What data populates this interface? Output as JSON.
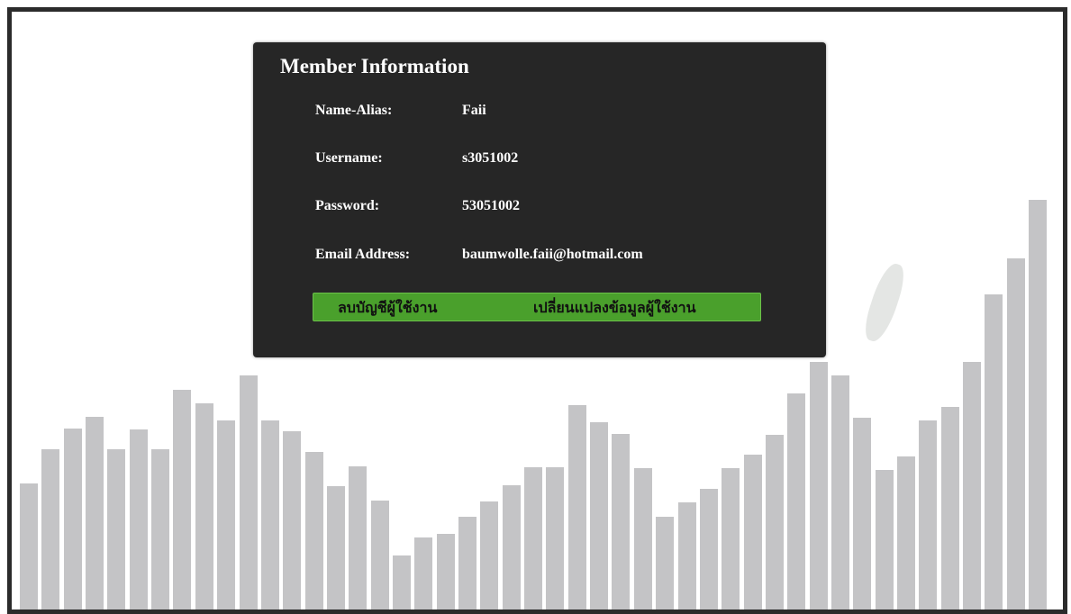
{
  "panel": {
    "title": "Member Information",
    "fields": [
      {
        "label": "Name-Alias:",
        "value": "Faii"
      },
      {
        "label": "Username:",
        "value": "s3051002"
      },
      {
        "label": "Password:",
        "value": "53051002"
      },
      {
        "label": "Email Address:",
        "value": "baumwolle.faii@hotmail.com"
      }
    ],
    "actions": {
      "delete_label": "ลบบัญชีผู้ใช้งาน",
      "edit_label": "เปลี่ยนแปลงข้อมูลผู้ใช้งาน"
    }
  },
  "background_bars": [
    140,
    178,
    201,
    214,
    178,
    200,
    178,
    244,
    229,
    210,
    260,
    210,
    198,
    175,
    137,
    159,
    121,
    60,
    80,
    84,
    103,
    120,
    138,
    158,
    158,
    227,
    208,
    195,
    157,
    103,
    119,
    134,
    157,
    172,
    194,
    240,
    275,
    260,
    213,
    155,
    170,
    210,
    225,
    275,
    350,
    390,
    455
  ],
  "colors": {
    "panel_bg": "#262626",
    "button_bg": "#4aa02c",
    "bar_color": "#c4c4c6",
    "frame_border": "#2b2b2b"
  }
}
